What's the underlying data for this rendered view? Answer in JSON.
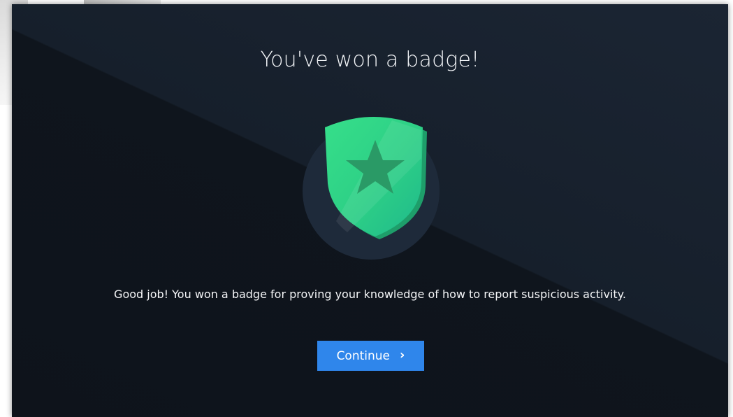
{
  "modal": {
    "title": "You've won a badge!",
    "message": "Good job! You won a badge for proving your knowledge of how to report suspicious activity.",
    "continue_label": "Continue",
    "continue_icon": "chevron-right-icon"
  },
  "badge": {
    "icon": "shield-star-icon",
    "shield_color": "#2fd17e",
    "star_color": "#2a9a66",
    "circle_color": "#1e2a3a"
  },
  "colors": {
    "button": "#2f86eb",
    "background": "#121a24"
  }
}
